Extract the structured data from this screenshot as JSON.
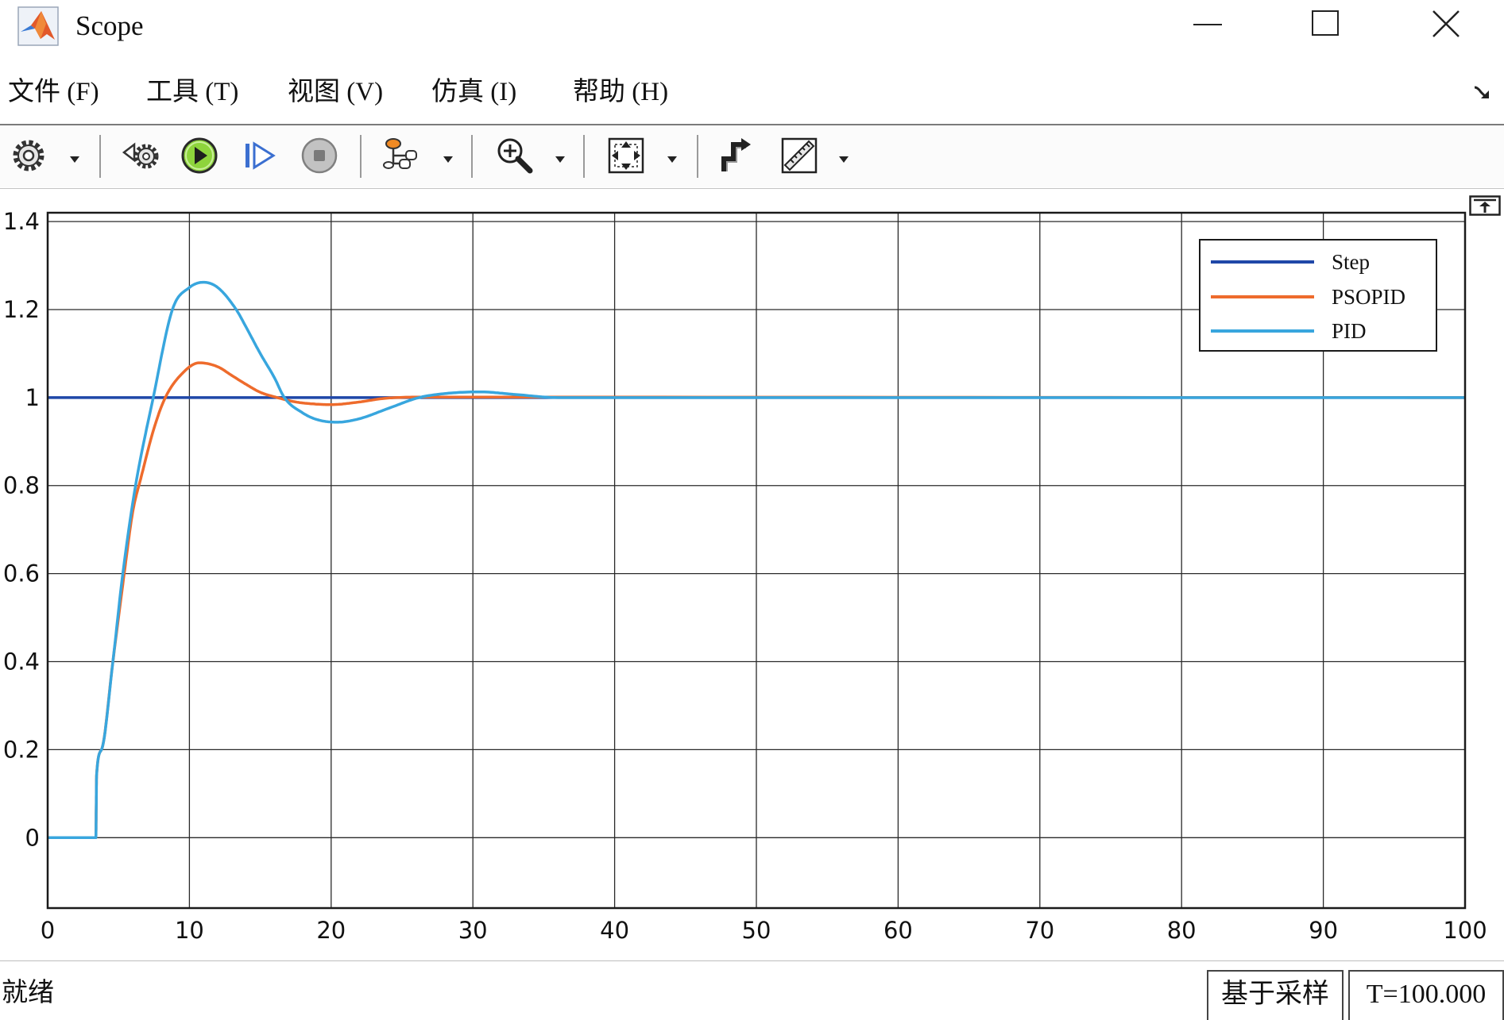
{
  "window": {
    "title": "Scope",
    "app_icon": "matlab-icon",
    "controls": [
      "minimize-icon",
      "maximize-icon",
      "close-icon"
    ]
  },
  "menu": {
    "items": [
      "文件 (F)",
      "工具 (T)",
      "视图 (V)",
      "仿真 (I)",
      "帮助 (H)"
    ],
    "expand_icon": "dock-arrow-icon"
  },
  "toolbar": {
    "items": [
      "gear-icon",
      "revert-icon",
      "play-icon",
      "step-forward-icon",
      "stop-icon",
      "signal-selector-icon",
      "zoom-in-icon",
      "fit-to-view-icon",
      "trigger-icon",
      "measure-icon"
    ],
    "dropdown_icon": "dropdown-arrow-icon"
  },
  "plot": {
    "undock_icon": "undock-icon"
  },
  "chart_data": {
    "type": "line",
    "xlim": [
      0,
      100
    ],
    "ylim": [
      -0.16,
      1.42
    ],
    "xticks": [
      "0",
      "10",
      "20",
      "30",
      "40",
      "50",
      "60",
      "70",
      "80",
      "90",
      "100"
    ],
    "yticks": [
      "0",
      "0.2",
      "0.4",
      "0.6",
      "0.8",
      "1",
      "1.2",
      "1.4"
    ],
    "grid": true,
    "legend": {
      "position": "top-right"
    },
    "series": [
      {
        "name": "Step",
        "color": "#1f47a8",
        "x": [
          0,
          100
        ],
        "y": [
          1,
          1
        ]
      },
      {
        "name": "PSOPID",
        "color": "#ee6b2c",
        "x": [
          0,
          3.4,
          3.45,
          3.8,
          4.6,
          5.4,
          6.0,
          6.6,
          7.5,
          8.3,
          9.5,
          10.7,
          12,
          13,
          14,
          15,
          16.2,
          17.5,
          19,
          20,
          22,
          23.7,
          26,
          30,
          100
        ],
        "y": [
          0,
          0,
          0.14,
          0.2,
          0.4,
          0.6,
          0.74,
          0.82,
          0.93,
          1.0,
          1.055,
          1.079,
          1.07,
          1.05,
          1.03,
          1.012,
          1.0,
          0.99,
          0.985,
          0.984,
          0.99,
          0.998,
          1.001,
          1.001,
          1.0
        ]
      },
      {
        "name": "PID",
        "color": "#38a6de",
        "x": [
          0,
          3.4,
          3.45,
          3.8,
          4.6,
          5.3,
          6.2,
          7.45,
          8.8,
          10,
          11,
          12,
          13.3,
          14,
          15,
          16,
          16.7,
          18,
          19,
          20.4,
          22,
          24,
          26.2,
          28,
          30.5,
          33,
          36,
          100
        ],
        "y": [
          0,
          0,
          0.14,
          0.2,
          0.4,
          0.6,
          0.8,
          1.0,
          1.2,
          1.25,
          1.262,
          1.25,
          1.2,
          1.16,
          1.1,
          1.045,
          1.0,
          0.965,
          0.95,
          0.944,
          0.952,
          0.975,
          1.0,
          1.009,
          1.013,
          1.007,
          1.0,
          1.0
        ]
      }
    ]
  },
  "status": {
    "state": "就绪",
    "mode": "基于采样",
    "time": "T=100.000"
  }
}
